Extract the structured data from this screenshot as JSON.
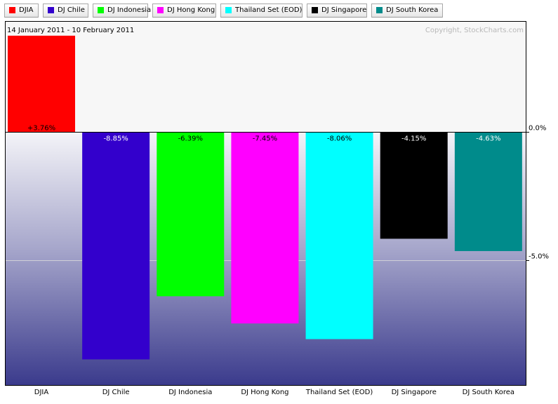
{
  "legend": {
    "items": [
      {
        "label": "DJIA",
        "color": "#ff0000"
      },
      {
        "label": "DJ Chile",
        "color": "#3300cc"
      },
      {
        "label": "DJ Indonesia",
        "color": "#00ff00"
      },
      {
        "label": "DJ Hong Kong",
        "color": "#ff00ff"
      },
      {
        "label": "Thailand Set (EOD)",
        "color": "#00ffff"
      },
      {
        "label": "DJ Singapore",
        "color": "#000000"
      },
      {
        "label": "DJ South Korea",
        "color": "#008b8b"
      }
    ]
  },
  "chart_data": {
    "type": "bar",
    "date_range": "14 January 2011 - 10 February 2011",
    "copyright": "Copyright, StockCharts.com",
    "categories": [
      "DJIA",
      "DJ Chile",
      "DJ Indonesia",
      "DJ Hong Kong",
      "Thailand Set (EOD)",
      "DJ Singapore",
      "DJ South Korea"
    ],
    "values": [
      3.76,
      -8.85,
      -6.39,
      -7.45,
      -8.06,
      -4.15,
      -4.63
    ],
    "value_labels": [
      "+3.76%",
      "-8.85%",
      "-6.39%",
      "-7.45%",
      "-8.06%",
      "-4.15%",
      "-4.63%"
    ],
    "colors": [
      "#ff0000",
      "#3300cc",
      "#00ff00",
      "#ff00ff",
      "#00ffff",
      "#000000",
      "#008b8b"
    ],
    "label_colors": [
      "#000000",
      "#ffffff",
      "#000000",
      "#000000",
      "#000000",
      "#ffffff",
      "#ffffff"
    ],
    "yticks": [
      0,
      -5
    ],
    "ytick_labels": [
      "0.0%",
      "-5.0%"
    ],
    "ylim": [
      -9.9,
      3.8
    ],
    "xlabel": "",
    "ylabel": ""
  }
}
